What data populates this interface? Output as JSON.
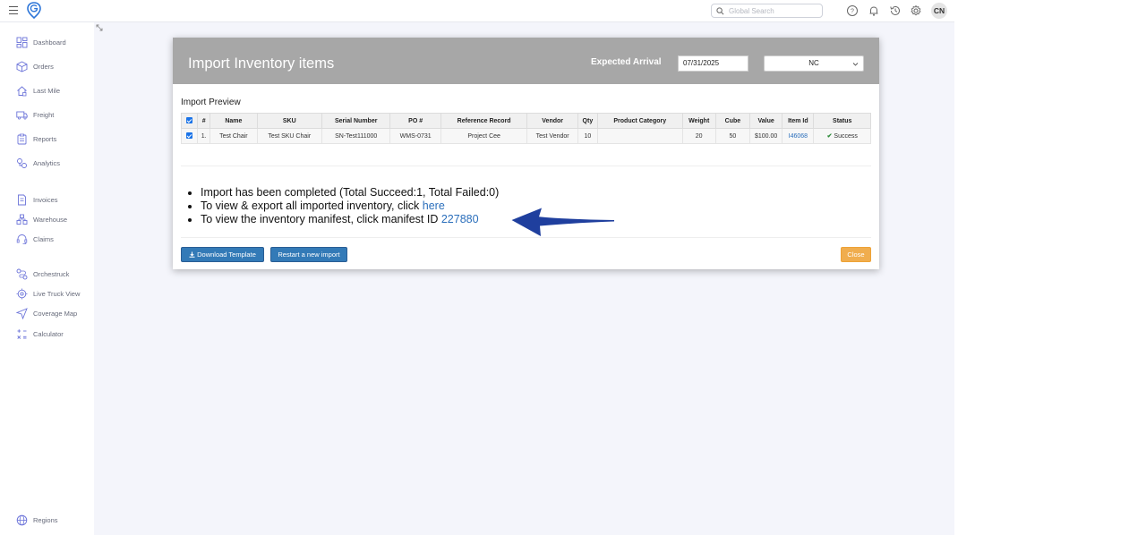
{
  "topbar": {
    "search_placeholder": "Global Search",
    "avatar_initials": "CN",
    "icons": [
      "menu-icon",
      "help-icon",
      "bell-icon",
      "history-icon",
      "gear-icon"
    ]
  },
  "sidebar": {
    "items": [
      {
        "label": "Dashboard",
        "icon": "dashboard-icon"
      },
      {
        "label": "Orders",
        "icon": "box-icon"
      },
      {
        "label": "Last Mile",
        "icon": "house-icon"
      },
      {
        "label": "Freight",
        "icon": "truck-icon"
      },
      {
        "label": "Reports",
        "icon": "clipboard-icon"
      },
      {
        "label": "Analytics",
        "icon": "analytics-icon"
      },
      {
        "label": "Invoices",
        "icon": "invoice-icon"
      },
      {
        "label": "Warehouse",
        "icon": "warehouse-icon"
      },
      {
        "label": "Claims",
        "icon": "headset-icon"
      },
      {
        "label": "Orchestruck",
        "icon": "route-icon"
      },
      {
        "label": "Live Truck View",
        "icon": "target-icon"
      },
      {
        "label": "Coverage Map",
        "icon": "navigation-icon"
      },
      {
        "label": "Calculator",
        "icon": "calculator-icon"
      },
      {
        "label": "Regions",
        "icon": "globe-icon"
      }
    ]
  },
  "modal": {
    "title": "Import Inventory items",
    "arrival_label": "Expected Arrival",
    "arrival_date": "07/31/2025",
    "state_select": "NC",
    "preview_title": "Import Preview",
    "columns": [
      "#",
      "Name",
      "SKU",
      "Serial Number",
      "PO #",
      "Reference Record",
      "Vendor",
      "Qty",
      "Product Category",
      "Weight",
      "Cube",
      "Value",
      "Item Id",
      "Status"
    ],
    "rows": [
      {
        "num": "1.",
        "name": "Test Chair",
        "sku": "Test SKU Chair",
        "serial": "SN-Test111000",
        "po": "WMS-0731",
        "reference": "Project Cee",
        "vendor": "Test Vendor",
        "qty": "10",
        "category": "",
        "weight": "20",
        "cube": "50",
        "value": "$100.00",
        "item_id": "I46068",
        "status": "Success"
      }
    ],
    "summary": {
      "line1": "Import has been completed (Total Succeed:1, Total Failed:0)",
      "line2_text": "To view & export all imported inventory, click ",
      "line2_link": "here",
      "line3_text": "To view the inventory manifest, click manifest ID ",
      "line3_link": "227880"
    },
    "buttons": {
      "download": "Download Template",
      "restart": "Restart a new import",
      "close": "Close"
    }
  },
  "colors": {
    "header_gray": "#a7a7a7",
    "primary_blue": "#337ab7",
    "close_orange": "#f0ad4e",
    "link_blue": "#2a6ebb",
    "arrow_navy": "#1f3f9e",
    "success_green": "#2e8b3a"
  }
}
